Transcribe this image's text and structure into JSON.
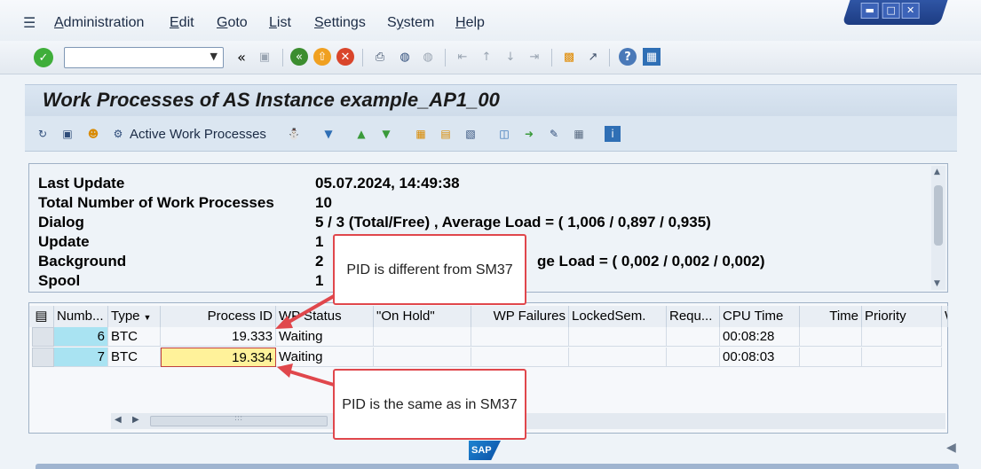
{
  "menu": {
    "items": [
      "Administration",
      "Edit",
      "Goto",
      "List",
      "Settings",
      "System",
      "Help"
    ],
    "underline_first": [
      "A",
      "E",
      "G",
      "L",
      "S",
      "y",
      "H"
    ]
  },
  "toolbar": {
    "command_field_value": "",
    "icons": [
      "enter-icon",
      "back-icon",
      "exit-icon",
      "cancel-icon",
      "print-icon",
      "find-icon",
      "find-next-icon",
      "first-page-icon",
      "previous-page-icon",
      "next-page-icon",
      "last-page-icon",
      "new-session-icon",
      "shortcut-icon",
      "help-icon",
      "layout-icon"
    ]
  },
  "title": "Work Processes of AS Instance example_AP1_00",
  "app_toolbar": {
    "active_work_processes_label": "Active Work Processes"
  },
  "info": {
    "rows": [
      {
        "label": "Last Update",
        "value": "05.07.2024, 14:49:38"
      },
      {
        "label": "Total Number of Work Processes",
        "value": "10"
      },
      {
        "label": "Dialog",
        "value": "5 / 3 (Total/Free) , Average Load = ( 1,006 / 0,897 / 0,935)"
      },
      {
        "label": "Update",
        "value": "1"
      },
      {
        "label": "Background",
        "value": "2",
        "value_tail": "ge Load = ( 0,002 / 0,002 / 0,002)"
      },
      {
        "label": "Spool",
        "value": "1"
      }
    ]
  },
  "grid": {
    "columns": [
      "Numb...",
      "Type",
      "Process ID",
      "WP Status",
      "\"On Hold\"",
      "WP Failures",
      "LockedSem.",
      "Requ...",
      "CPU Time",
      "Time",
      "Priority",
      "W"
    ],
    "rows": [
      {
        "number": "6",
        "type": "BTC",
        "pid": "19.333",
        "status": "Waiting",
        "cpu_time": "00:08:28"
      },
      {
        "number": "7",
        "type": "BTC",
        "pid": "19.334",
        "status": "Waiting",
        "cpu_time": "00:08:03"
      }
    ],
    "h_scroll_grip": ":::"
  },
  "callouts": {
    "top": "PID is different from SM37",
    "bottom": "PID is the same as in SM37"
  },
  "logo_text": "SAP",
  "colors": {
    "number_cell": "#a9e3f2",
    "highlight_cell": "#fff29a",
    "callout_border": "#e0474c",
    "window_controls": "#2f55a5"
  }
}
